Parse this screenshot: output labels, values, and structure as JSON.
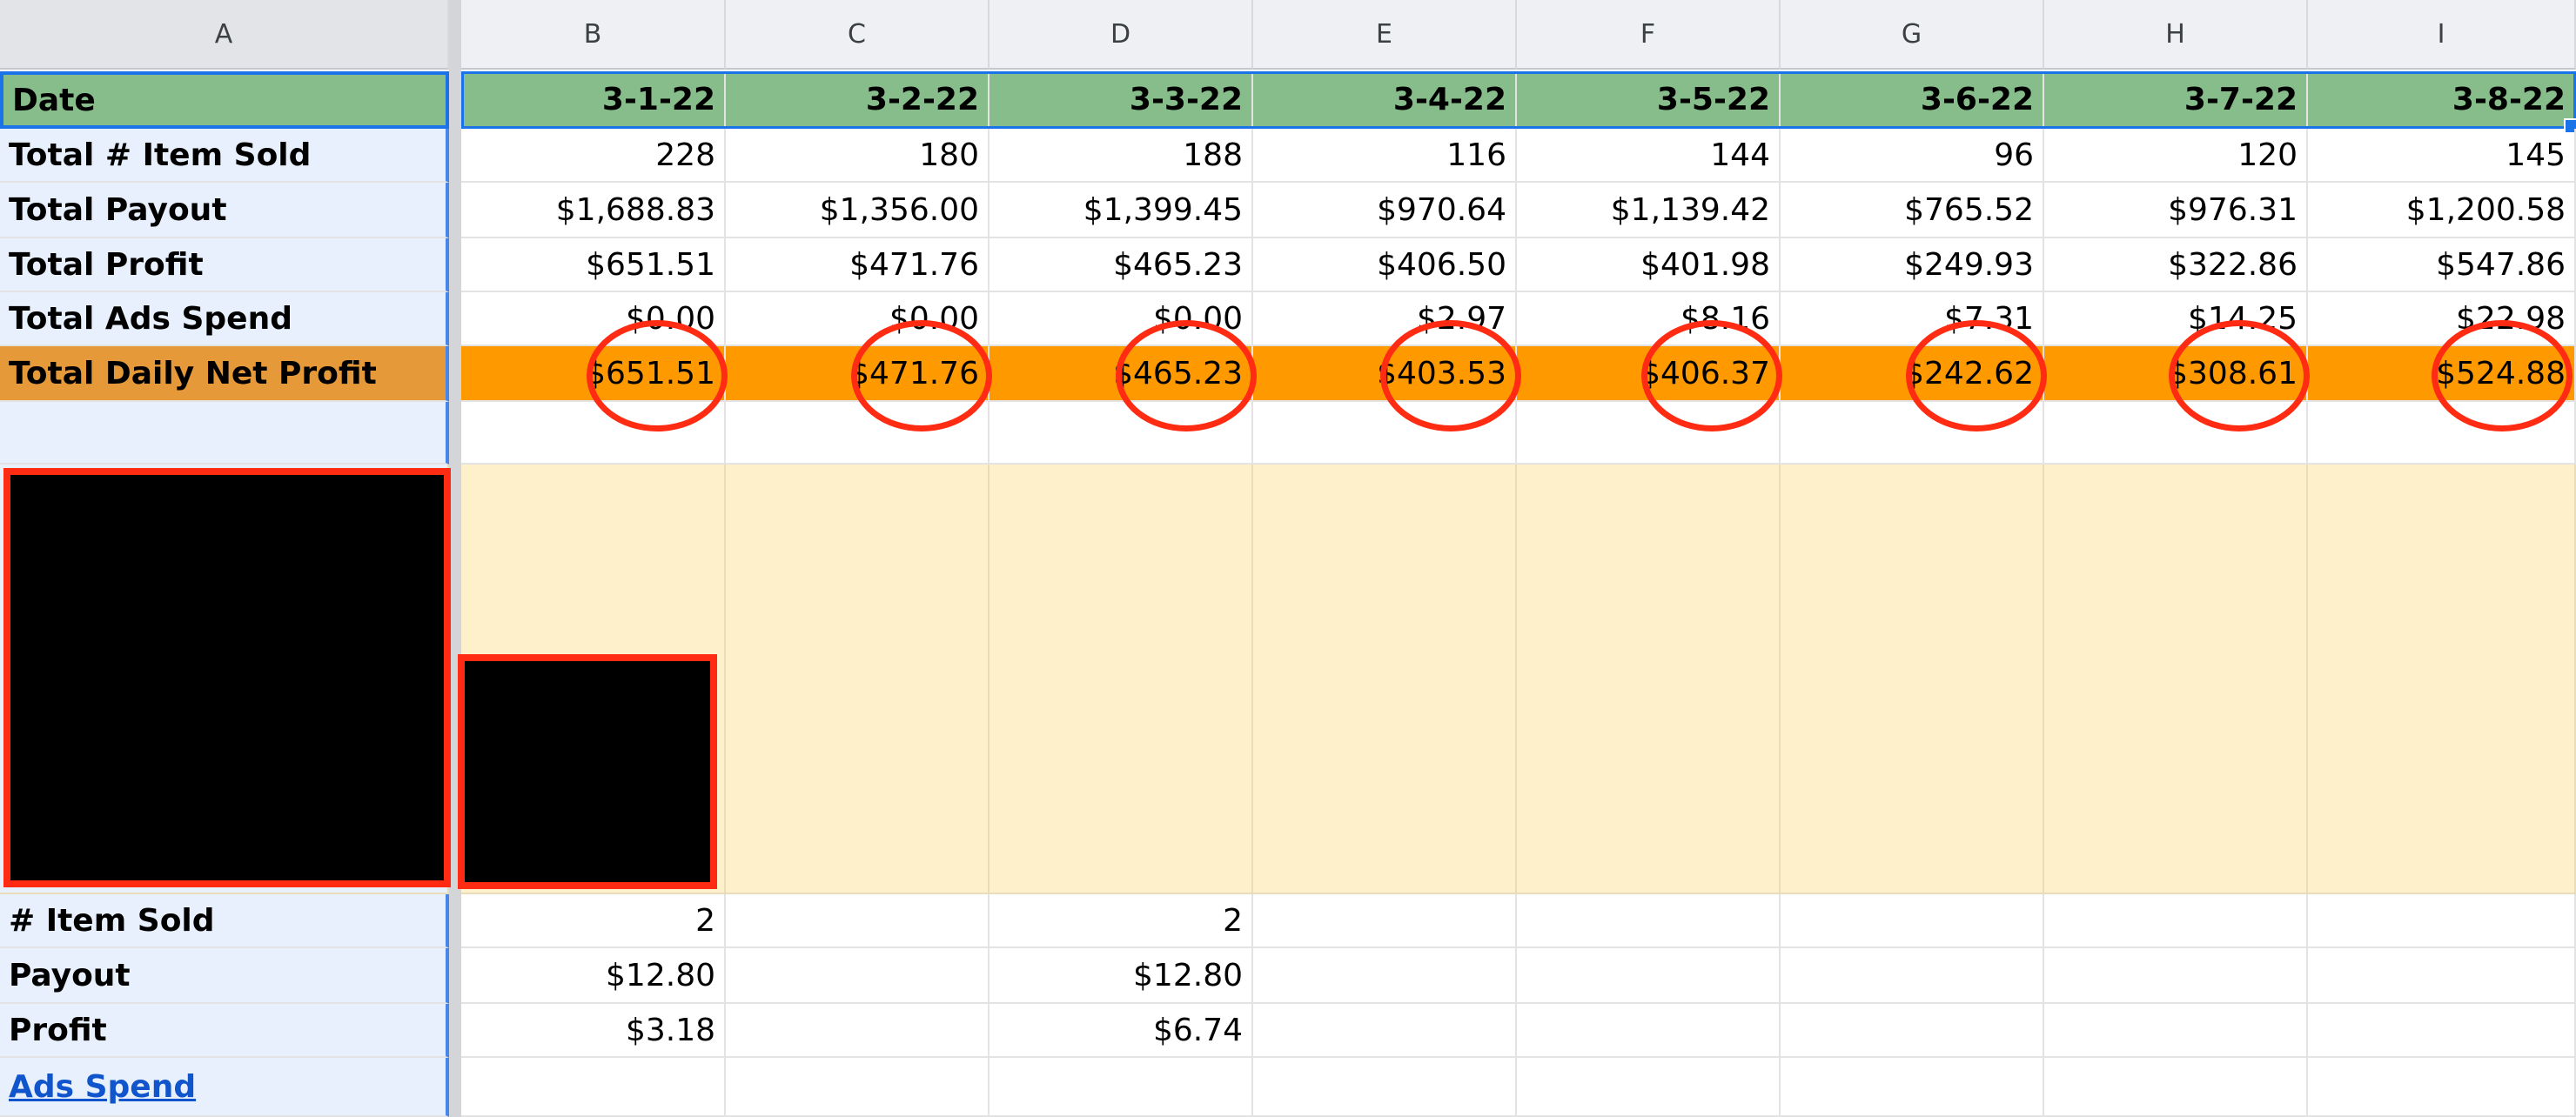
{
  "columns": [
    "A",
    "B",
    "C",
    "D",
    "E",
    "F",
    "G",
    "H",
    "I"
  ],
  "header_row": {
    "label": "Date",
    "values": [
      "3-1-22",
      "3-2-22",
      "3-3-22",
      "3-4-22",
      "3-5-22",
      "3-6-22",
      "3-7-22",
      "3-8-22"
    ]
  },
  "summary_rows": [
    {
      "label": "Total # Item Sold",
      "values": [
        "228",
        "180",
        "188",
        "116",
        "144",
        "96",
        "120",
        "145"
      ]
    },
    {
      "label": "Total Payout",
      "values": [
        "$1,688.83",
        "$1,356.00",
        "$1,399.45",
        "$970.64",
        "$1,139.42",
        "$765.52",
        "$976.31",
        "$1,200.58"
      ]
    },
    {
      "label": "Total Profit",
      "values": [
        "$651.51",
        "$471.76",
        "$465.23",
        "$406.50",
        "$401.98",
        "$249.93",
        "$322.86",
        "$547.86"
      ]
    },
    {
      "label": "Total Ads Spend",
      "values": [
        "$0.00",
        "$0.00",
        "$0.00",
        "$2.97",
        "$8.16",
        "$7.31",
        "$14.25",
        "$22.98"
      ]
    }
  ],
  "net_row": {
    "label": "Total Daily Net Profit",
    "values": [
      "$651.51",
      "$471.76",
      "$465.23",
      "$403.53",
      "$406.37",
      "$242.62",
      "$308.61",
      "$524.88"
    ]
  },
  "detail_rows": [
    {
      "label": "# Item Sold",
      "values": [
        "2",
        "",
        "2",
        "",
        "",
        "",
        "",
        ""
      ]
    },
    {
      "label": "Payout",
      "values": [
        "$12.80",
        "",
        "$12.80",
        "",
        "",
        "",
        "",
        ""
      ]
    },
    {
      "label": "Profit",
      "values": [
        "$3.18",
        "",
        "$6.74",
        "",
        "",
        "",
        "",
        ""
      ]
    },
    {
      "label": "Ads Spend",
      "values": [
        "",
        "",
        "",
        "",
        "",
        "",
        "",
        ""
      ]
    }
  ],
  "colors": {
    "header_green": "#87bd8a",
    "net_orange": "#ff9900",
    "annotation_red": "#ff2b12",
    "cream": "#fff0cc",
    "label_blue": "#e8f0fd"
  }
}
